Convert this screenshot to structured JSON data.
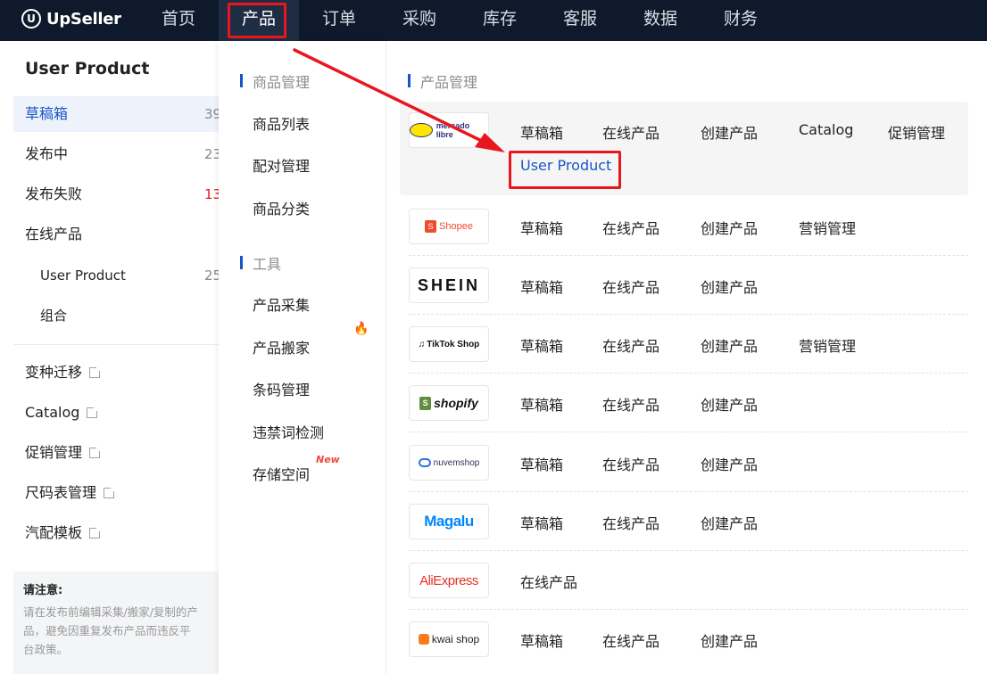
{
  "topbar": {
    "logo_text": "UpSeller",
    "nav": [
      "首页",
      "产品",
      "订单",
      "采购",
      "库存",
      "客服",
      "数据",
      "财务"
    ],
    "active_nav": "产品"
  },
  "sidebar": {
    "title": "User Product",
    "items": [
      {
        "label": "草稿箱",
        "count": "39"
      },
      {
        "label": "发布中",
        "count": "23"
      },
      {
        "label": "发布失败",
        "count": "13"
      },
      {
        "label": "在线产品",
        "count": ""
      },
      {
        "label": "User Product",
        "count": "25"
      },
      {
        "label": "组合",
        "count": ""
      }
    ],
    "links": [
      "变种迁移",
      "Catalog",
      "促销管理",
      "尺码表管理",
      "汽配模板"
    ],
    "notice_title": "请注意:",
    "notice_lines": [
      "请在发布前编辑采集/搬家/复制的产",
      "品，避免因重复发布产品而违反平",
      "台政策。"
    ]
  },
  "midmenu": {
    "section1": "商品管理",
    "section1_items": [
      "商品列表",
      "配对管理",
      "商品分类"
    ],
    "section2": "工具",
    "section2_items": [
      "产品采集",
      "产品搬家",
      "条码管理",
      "违禁词检测",
      "存储空间"
    ],
    "new_badge": "New"
  },
  "rightpanel": {
    "section": "产品管理",
    "platforms": [
      {
        "logo": "mercado-libre",
        "logo_text": "mercado libre",
        "links": [
          "草稿箱",
          "在线产品",
          "创建产品",
          "Catalog",
          "促销管理"
        ],
        "extra_link": "User Product"
      },
      {
        "logo": "shopee",
        "logo_text": "Shopee",
        "links": [
          "草稿箱",
          "在线产品",
          "创建产品",
          "营销管理"
        ]
      },
      {
        "logo": "shein",
        "logo_text": "SHEIN",
        "links": [
          "草稿箱",
          "在线产品",
          "创建产品"
        ]
      },
      {
        "logo": "tiktok-shop",
        "logo_text": "TikTok Shop",
        "links": [
          "草稿箱",
          "在线产品",
          "创建产品",
          "营销管理"
        ]
      },
      {
        "logo": "shopify",
        "logo_text": "shopify",
        "links": [
          "草稿箱",
          "在线产品",
          "创建产品"
        ]
      },
      {
        "logo": "nuvemshop",
        "logo_text": "nuvemshop",
        "links": [
          "草稿箱",
          "在线产品",
          "创建产品"
        ]
      },
      {
        "logo": "magalu",
        "logo_text": "Magalu",
        "links": [
          "草稿箱",
          "在线产品",
          "创建产品"
        ]
      },
      {
        "logo": "aliexpress",
        "logo_text": "AliExpress",
        "links": [
          "在线产品"
        ]
      },
      {
        "logo": "kwai-shop",
        "logo_text": "kwai shop",
        "links": [
          "草稿箱",
          "在线产品",
          "创建产品"
        ]
      }
    ]
  },
  "colors": {
    "topbar_bg": "#0e1a2b",
    "accent_blue": "#1a55c8",
    "annotation_red": "#e8161e"
  }
}
